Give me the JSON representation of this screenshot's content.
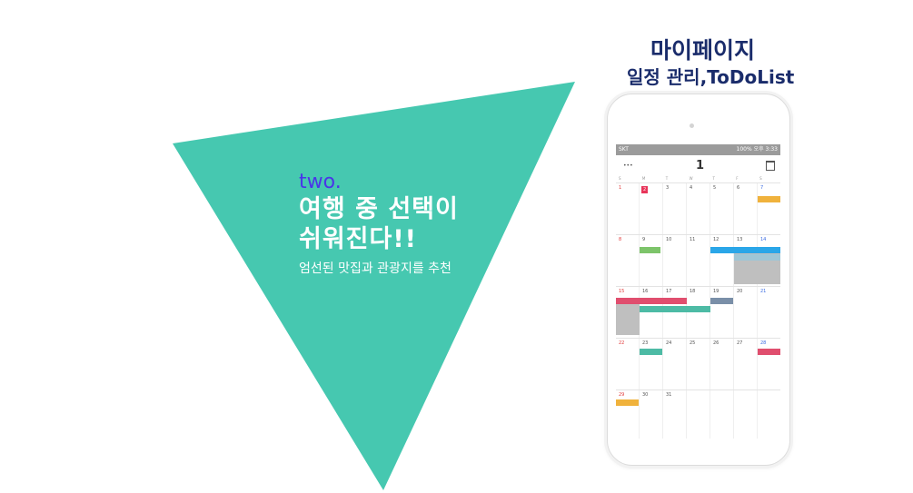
{
  "slide": {
    "label": "two.",
    "headline_line1": "여행 중 선택이",
    "headline_line2": "쉬워진다!!",
    "subtitle": "엄선된 맛집과 관광지를 추천"
  },
  "header": {
    "title": "마이페이지",
    "subtitle": "일정 관리,ToDoList"
  },
  "colors": {
    "triangle": "#46c8b0",
    "accent_label": "#4a35e8",
    "heading": "#1a2c6b",
    "today": "#e8355a"
  },
  "phone": {
    "status_left": "SKT",
    "status_right": "100% 오후 3:33",
    "month": "1",
    "weekdays": [
      "S",
      "M",
      "T",
      "W",
      "T",
      "F",
      "S"
    ],
    "weeks": [
      [
        "1",
        "2",
        "3",
        "4",
        "5",
        "6",
        "7"
      ],
      [
        "8",
        "9",
        "10",
        "11",
        "12",
        "13",
        "14"
      ],
      [
        "15",
        "16",
        "17",
        "18",
        "19",
        "20",
        "21"
      ],
      [
        "22",
        "23",
        "24",
        "25",
        "26",
        "27",
        "28"
      ],
      [
        "29",
        "30",
        "31",
        "",
        "",
        "",
        ""
      ]
    ],
    "today": "2"
  }
}
